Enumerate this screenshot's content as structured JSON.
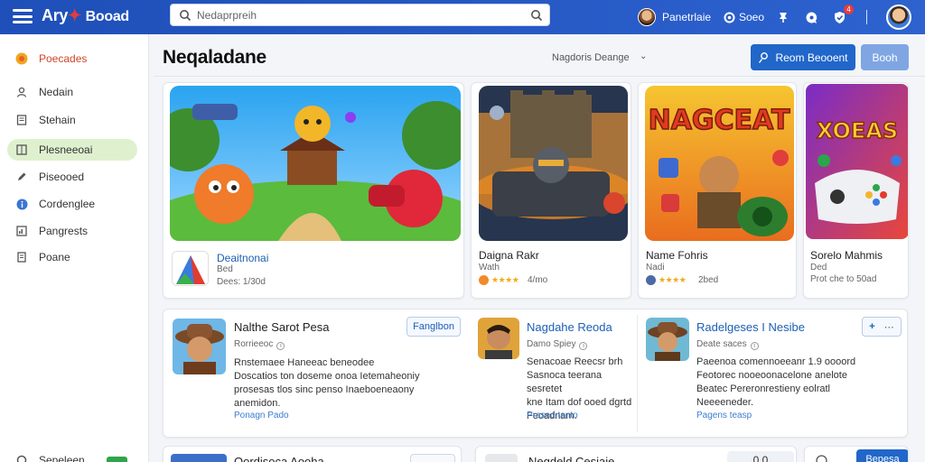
{
  "topbar": {
    "brand_main": "Ary",
    "brand_sub": "Booad",
    "search_placeholder": "Nedaprpreih",
    "username": "Panetrlaie",
    "extra_label": "Soeo",
    "notification_count": "4"
  },
  "sidebar": {
    "items": [
      {
        "label": "Poecades",
        "icon": "star-icon"
      },
      {
        "label": "Nedain",
        "icon": "person-icon"
      },
      {
        "label": "Stehain",
        "icon": "document-icon"
      },
      {
        "label": "Plesneeoai",
        "icon": "grid-icon"
      },
      {
        "label": "Piseooed",
        "icon": "pencil-icon"
      },
      {
        "label": "Cordenglee",
        "icon": "info-icon"
      },
      {
        "label": "Pangrests",
        "icon": "bars-icon"
      },
      {
        "label": "Poane",
        "icon": "page-icon"
      }
    ],
    "bottom_label": "Sepeleen",
    "active_index": 3
  },
  "header": {
    "title": "Neqaladane",
    "sort_label": "Nagdoris Deange",
    "primary_button": "Reom Beooent",
    "secondary_button": "Booh"
  },
  "featured": [
    {
      "title": "Deaitnonai",
      "subtitle": "Bed",
      "meta": "Dees: 1/30d"
    },
    {
      "title": "Daigna Rakr",
      "subtitle": "Wath",
      "rating": "4/mo"
    },
    {
      "title": "Name Fohris",
      "subtitle": "Nadi",
      "rating": "2bed",
      "art_text": "NAGCEAT"
    },
    {
      "title": "Sorelo Mahmis",
      "subtitle": "Ded",
      "meta": "Prot che to 50ad",
      "art_text": "XOEAS"
    }
  ],
  "reviews": [
    {
      "title": "Nalthe Sarot Pesa",
      "subtitle": "Rorrieeoc",
      "button": "Fanglbon",
      "description": "Rnstemaee Haneeac beneodee\nDoscatios ton doseme onoa Ietemaheoniy\nprosesas tlos sinc penso Inaeboeneaony\nanemidon.",
      "link": "Ponagn Pado"
    },
    {
      "title": "Nagdahe Reoda",
      "subtitle": "Damo Spiey",
      "description": "Senacoae Reecsr brh\nSasnoca teerana sesretet\nkne Itam dof ooed dgrtd\nFeoadnam.",
      "link": "Prased tanto"
    },
    {
      "title": "Radelgeses I Nesibe",
      "subtitle": "Deate saces",
      "button": "+",
      "description": "Paeenoa comennoeeanr 1.9 oooord\nFeotorec nooeoonacelone anelote\nBeatec Pereronrestieny eolratl\nNeeeeneder.",
      "link": "Pagens teasp"
    }
  ],
  "bottom_row": {
    "card1_title": "Oordisoca Aooha",
    "card2_title": "Negdeld Cesiaie",
    "card2_value": "0.0",
    "card3_button": "Bepesa"
  },
  "colors": {
    "topbar": "#2558c4",
    "accent": "#2166c9",
    "active_sidebar": "#dff0cf",
    "star": "#f1a916"
  }
}
